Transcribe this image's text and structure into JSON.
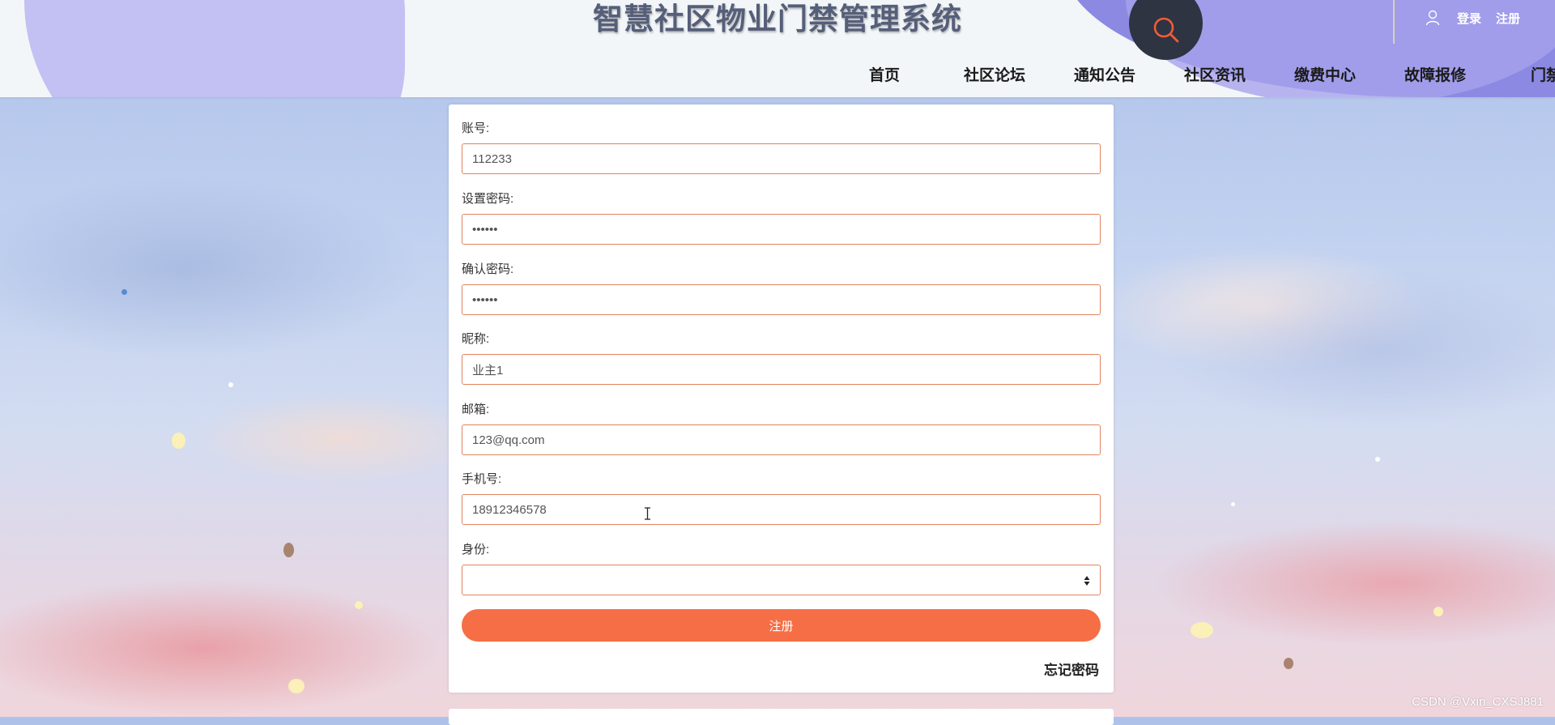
{
  "header": {
    "site_title": "智慧社区物业门禁管理系统",
    "login": "登录",
    "register": "注册",
    "nav": [
      "首页",
      "社区论坛",
      "通知公告",
      "社区资讯",
      "缴费中心",
      "故障报修",
      "门禁列表"
    ]
  },
  "form": {
    "account": {
      "label": "账号:",
      "value": "112233"
    },
    "password": {
      "label": "设置密码:",
      "value": "••••••"
    },
    "confirm_password": {
      "label": "确认密码:",
      "value": "••••••"
    },
    "nickname": {
      "label": "昵称:",
      "value": "业主1"
    },
    "email": {
      "label": "邮箱:",
      "value": "123@qq.com"
    },
    "phone": {
      "label": "手机号:",
      "value": "18912346578"
    },
    "identity": {
      "label": "身份:",
      "value": ""
    },
    "submit_label": "注册",
    "forgot_label": "忘记密码"
  },
  "watermark": "CSDN @Vxin_CXSJ881",
  "colors": {
    "accent": "#f66e45",
    "input_border": "#e0845e",
    "header_bg": "#f3f6f8",
    "nav_blob": "#8c89e2"
  },
  "icons": {
    "search": "search-icon",
    "user": "user-icon",
    "select": "select-arrows-icon"
  }
}
